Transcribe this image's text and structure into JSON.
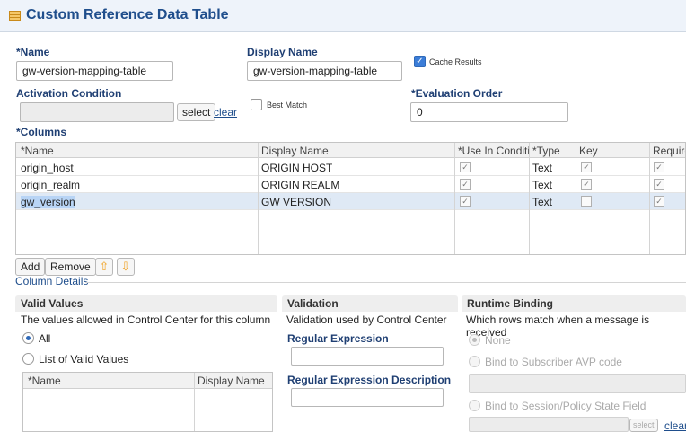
{
  "header": {
    "title": "Custom Reference Data Table"
  },
  "form": {
    "name_label": "*Name",
    "name_value": "gw-version-mapping-table",
    "display_name_label": "Display Name",
    "display_name_value": "gw-version-mapping-table",
    "cache_results_label": "Cache Results",
    "cache_results_checked": true,
    "activation_label": "Activation Condition",
    "activation_value": "",
    "select_label": "select",
    "clear_label": "clear",
    "best_match_label": "Best Match",
    "best_match_checked": false,
    "eval_order_label": "*Evaluation Order",
    "eval_order_value": "0"
  },
  "columns": {
    "label": "*Columns",
    "headers": [
      "*Name",
      "Display Name",
      "*Use In Conditic",
      "*Type",
      "Key",
      "Required"
    ],
    "rows": [
      {
        "name": "origin_host",
        "display": "ORIGIN HOST",
        "type": "Text",
        "use": true,
        "key": true,
        "required": true
      },
      {
        "name": "origin_realm",
        "display": "ORIGIN REALM",
        "type": "Text",
        "use": true,
        "key": true,
        "required": true
      },
      {
        "name": "gw_version",
        "display": "GW VERSION",
        "type": "Text",
        "use": true,
        "key": false,
        "required": true
      }
    ],
    "buttons": {
      "add": "Add",
      "remove": "Remove"
    }
  },
  "column_details": {
    "title": "Column Details",
    "valid_values": {
      "title": "Valid Values",
      "desc": "The values allowed in Control Center for this column",
      "all_label": "All",
      "list_label": "List of Valid Values",
      "table_headers": [
        "*Name",
        "Display Name"
      ]
    },
    "validation": {
      "title": "Validation",
      "desc": "Validation used by Control Center",
      "regex_label": "Regular Expression",
      "regex_desc_label": "Regular Expression Description"
    },
    "runtime": {
      "title": "Runtime Binding",
      "desc": "Which rows match when a message is received",
      "none_label": "None",
      "subscriber_label": "Bind to Subscriber AVP code",
      "session_label": "Bind to Session/Policy State Field",
      "select_label": "select",
      "clear_label": "clear"
    }
  },
  "colors": {
    "title": "#1f4e8c",
    "accent": "#3b7dd8",
    "selection": "#b8d4f5"
  }
}
